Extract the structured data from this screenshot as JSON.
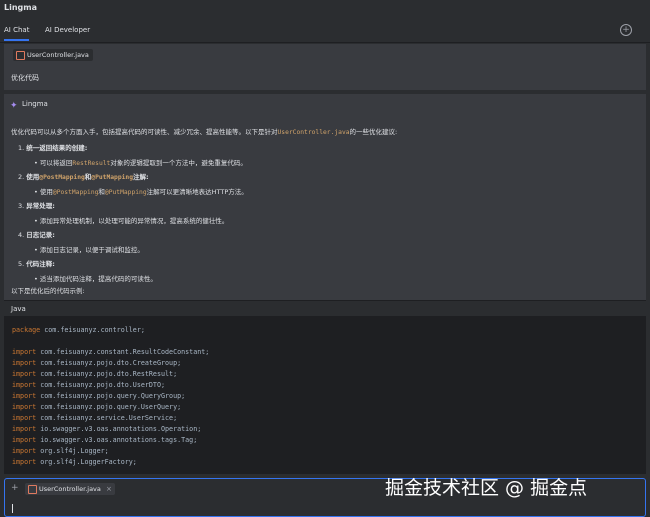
{
  "app": {
    "title": "Lingma"
  },
  "tabs": [
    {
      "label": "AI Chat"
    },
    {
      "label": "AI Developer"
    }
  ],
  "user_message": {
    "file_chip": "UserController.java",
    "text": "优化代码"
  },
  "assistant": {
    "name": "Lingma",
    "intro_prefix": "优化代码可以从多个方面入手，包括提高代码的可读性、减少冗余、提高性能等。以下是针对",
    "intro_code": "UserController.java",
    "intro_suffix": "的一些优化建议:",
    "items": [
      {
        "num": "1.",
        "title": "统一返回结果的创建:",
        "detail_prefix": "可以将返回",
        "detail_code": "RestResult",
        "detail_suffix": "对象的逻辑提取到一个方法中，避免重复代码。"
      },
      {
        "num": "2.",
        "title_prefix": "使用",
        "title_code1": "@PostMapping",
        "title_mid": "和",
        "title_code2": "@PutMapping",
        "title_suffix": "注解:",
        "detail_prefix": "使用",
        "detail_code1": "@PostMapping",
        "detail_mid": "和",
        "detail_code2": "@PutMapping",
        "detail_suffix": "注解可以更清晰地表达HTTP方法。"
      },
      {
        "num": "3.",
        "title": "异常处理:",
        "detail": "添加异常处理机制，以处理可能的异常情况，提高系统的健壮性。"
      },
      {
        "num": "4.",
        "title": "日志记录:",
        "detail": "添加日志记录，以便于调试和监控。"
      },
      {
        "num": "5.",
        "title": "代码注释:",
        "detail": "适当添加代码注释，提高代码的可读性。"
      }
    ],
    "outro": "以下是优化后的代码示例:"
  },
  "code_block": {
    "language": "Java",
    "lines": [
      {
        "kw": "package",
        "rest": " com.feisuanyz.controller;"
      },
      {
        "kw": "import",
        "rest": " com.feisuanyz.constant.ResultCodeConstant;"
      },
      {
        "kw": "import",
        "rest": " com.feisuanyz.pojo.dto.CreateGroup;"
      },
      {
        "kw": "import",
        "rest": " com.feisuanyz.pojo.dto.RestResult;"
      },
      {
        "kw": "import",
        "rest": " com.feisuanyz.pojo.dto.UserDTO;"
      },
      {
        "kw": "import",
        "rest": " com.feisuanyz.pojo.query.QueryGroup;"
      },
      {
        "kw": "import",
        "rest": " com.feisuanyz.pojo.query.UserQuery;"
      },
      {
        "kw": "import",
        "rest": " com.feisuanyz.service.UserService;"
      },
      {
        "kw": "import",
        "rest": " io.swagger.v3.oas.annotations.Operation;"
      },
      {
        "kw": "import",
        "rest": " io.swagger.v3.oas.annotations.tags.Tag;"
      },
      {
        "kw": "import",
        "rest": " org.slf4j.Logger;"
      },
      {
        "kw": "import",
        "rest": " org.slf4j.LoggerFactory;"
      }
    ]
  },
  "input": {
    "file_chip": "UserController.java",
    "remove_symbol": "×"
  },
  "watermark": "掘金技术社区 @ 掘金点"
}
